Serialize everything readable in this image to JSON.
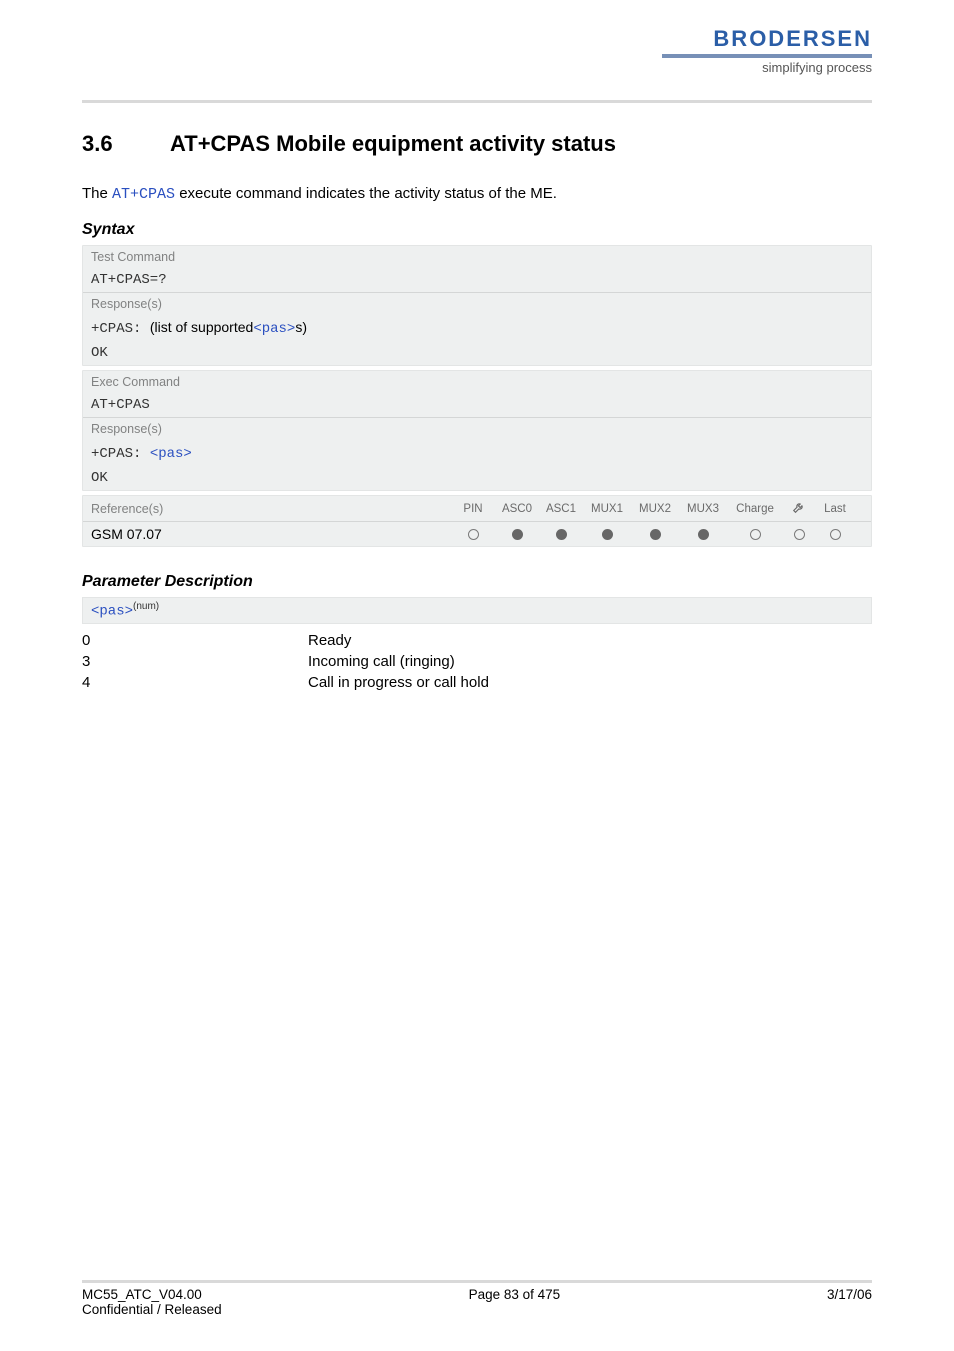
{
  "logo": {
    "brand": "BRODERSEN",
    "sub": "simplifying process"
  },
  "section": {
    "num": "3.6",
    "title": "AT+CPAS   Mobile equipment activity status"
  },
  "intro": {
    "pre": "The ",
    "cmd": "AT+CPAS",
    "post": " execute command indicates the activity status of the ME."
  },
  "syntax_heading": "Syntax",
  "test_block": {
    "label": "Test Command",
    "cmd": "AT+CPAS=?",
    "resp_label": "Response(s)",
    "resp_prefix": "+CPAS: ",
    "resp_text": "(list of supported",
    "resp_param": "<pas>",
    "resp_suffix": "s)",
    "ok": "OK"
  },
  "exec_block": {
    "label": "Exec Command",
    "cmd": "AT+CPAS",
    "resp_label": "Response(s)",
    "resp_prefix": "+CPAS: ",
    "resp_param": "<pas>",
    "ok": "OK"
  },
  "ref": {
    "label": "Reference(s)",
    "value": "GSM 07.07",
    "cols": [
      "PIN",
      "ASC0",
      "ASC1",
      "MUX1",
      "MUX2",
      "MUX3",
      "Charge",
      "",
      "Last"
    ],
    "dots": [
      "empty",
      "full",
      "full",
      "full",
      "full",
      "full",
      "empty",
      "empty",
      "empty"
    ]
  },
  "param_heading": "Parameter Description",
  "param_name": "<pas>",
  "param_sup": "(num)",
  "params": [
    {
      "k": "0",
      "v": "Ready"
    },
    {
      "k": "3",
      "v": "Incoming call (ringing)"
    },
    {
      "k": "4",
      "v": "Call in progress or call hold"
    }
  ],
  "footer": {
    "l1": "MC55_ATC_V04.00",
    "c1": "Page 83 of 475",
    "r1": "3/17/06",
    "l2": "Confidential / Released"
  }
}
